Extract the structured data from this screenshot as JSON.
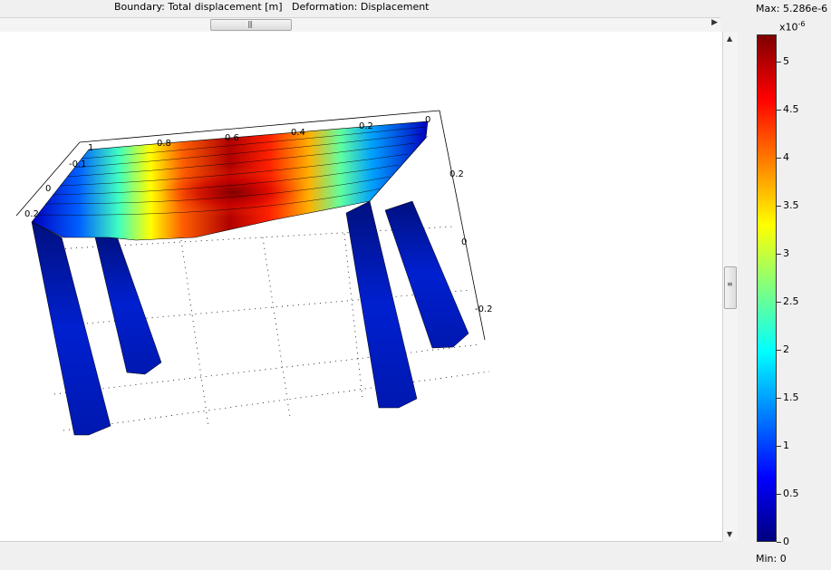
{
  "header": {
    "plot_title": "Boundary: Total displacement [m]   Deformation: Displacement"
  },
  "scrollbars": {
    "h_grip": "|||",
    "v_grip": "≡"
  },
  "legend": {
    "max_label": "Max: 5.286e-6",
    "min_label": "Min: 0",
    "exponent_base": "x10",
    "exponent_power": "-6",
    "colormap": "jet",
    "ticks": [
      "5",
      "4.5",
      "4",
      "3.5",
      "3",
      "2.5",
      "2",
      "1.5",
      "1",
      "0.5",
      "0"
    ],
    "range": [
      0,
      5.286
    ]
  },
  "axes": {
    "top_ticks": [
      "1",
      "0.8",
      "0.6",
      "0.4",
      "0.2",
      "0"
    ],
    "left_ticks": [
      "-0.1",
      "0",
      "0.2"
    ],
    "right_ticks": [
      "0.2",
      "0",
      "-0.2"
    ]
  },
  "colors": {
    "low": "#00007f",
    "mid": "#ffff00",
    "high": "#7f0000",
    "canvas_background": "#ffffff"
  }
}
